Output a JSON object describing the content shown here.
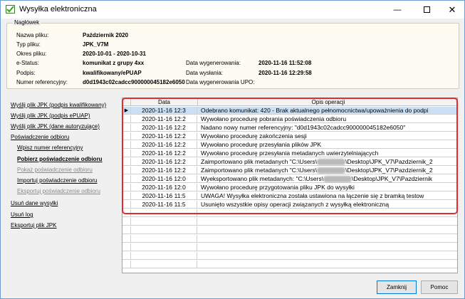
{
  "window": {
    "title": "Wysyłka elektroniczna"
  },
  "header": {
    "legend": "Nagłówek",
    "left": [
      {
        "label": "Nazwa pliku:",
        "value": "Październik 2020"
      },
      {
        "label": "Typ pliku:",
        "value": "JPK_V7M"
      },
      {
        "label": "Okres pliku:",
        "value": "2020-10-01 - 2020-10-31"
      },
      {
        "label": "e-Status:",
        "value": "komunikat z grupy 4xx"
      },
      {
        "label": "Podpis:",
        "value": "kwalifikowany/ePUAP"
      },
      {
        "label": "Numer referencyjny:",
        "value": "d0d1943c02cadcc900000045182e6050"
      }
    ],
    "right": [
      {
        "label": "Data wygenerowania:",
        "value": "2020-11-16 11:52:08"
      },
      {
        "label": "Data wysłania:",
        "value": "2020-11-16 12:29:58"
      },
      {
        "label": "Data wygenerowania UPO:",
        "value": ""
      }
    ]
  },
  "sidebar": [
    {
      "label": "Wyślij plik JPK (podpis kwalifikowany)",
      "disabled": false
    },
    {
      "label": "Wyślij plik JPK (podpis ePUAP)",
      "disabled": false
    },
    {
      "label": "Wyślij plik JPK (dane autoryzujące)",
      "disabled": false
    },
    {
      "label": "Poświadczenie odbioru",
      "disabled": false
    },
    {
      "label": "Wpisz numer referencyjny",
      "disabled": false
    },
    {
      "label": "Pobierz poświadczenie odbioru",
      "disabled": false
    },
    {
      "label": "Pokaż poświadczenie odbioru",
      "disabled": true
    },
    {
      "label": "Importuj poświadczenie odbioru",
      "disabled": false
    },
    {
      "label": "Eksportuj poświadczenie odbioru",
      "disabled": true
    },
    {
      "label": "Usuń dane wysyłki",
      "disabled": false
    },
    {
      "label": "Usuń log",
      "disabled": false
    },
    {
      "label": "Eksportuj plik JPK",
      "disabled": false
    }
  ],
  "grid": {
    "columns": [
      "Data",
      "Opis operacji"
    ],
    "rows": [
      {
        "date": "2020-11-16 12:3",
        "desc": "Odebrano komunikat: 420 - Brak aktualnego pełnomocnictwa/upoważnienia do podpi",
        "selected": true
      },
      {
        "date": "2020-11-16 12:2",
        "desc": "Wywołano procedurę pobrania poświadczenia odbioru"
      },
      {
        "date": "2020-11-16 12:2",
        "desc": "Nadano nowy numer referencyjny: \"d0d1943c02cadcc900000045182e6050\""
      },
      {
        "date": "2020-11-16 12:2",
        "desc": "Wywołano procedurę zakończenia sesji"
      },
      {
        "date": "2020-11-16 12:2",
        "desc": "Wywołano procedurę przesyłania plików JPK"
      },
      {
        "date": "2020-11-16 12:2",
        "desc": "Wywołano procedurę przesyłania metadanych uwierzytelniających"
      },
      {
        "date": "2020-11-16 12:2",
        "desc_a": "Zaimportowano plik metadanych \"C:\\Users\\",
        "desc_b": "\\Desktop\\JPK_V7\\Pazdziernik_2"
      },
      {
        "date": "2020-11-16 12:2",
        "desc_a": "Zaimportowano plik metadanych \"C:\\Users\\",
        "desc_b": "\\Desktop\\JPK_V7\\Pazdziernik_2"
      },
      {
        "date": "2020-11-16 12:0",
        "desc_a": "Wyeksportowano plik metadanych: \"C:\\Users\\",
        "desc_b": "\\Desktop\\JPK_V7\\Pazdziernik"
      },
      {
        "date": "2020-11-16 12:0",
        "desc": "Wywołano procedurę przygotowania pliku JPK do wysyłki"
      },
      {
        "date": "2020-11-16 11:5",
        "desc": "UWAGA! Wysyłka elektroniczna została ustawiona na łączenie się z bramką testow"
      },
      {
        "date": "2020-11-16 11:5",
        "desc": "Usunięto wszystkie opisy operacji związanych z wysyłką elektroniczną"
      }
    ],
    "empty_rows": 7
  },
  "buttons": {
    "close": "Zamknij",
    "help": "Pomoc"
  },
  "colors": {
    "highlight": "#e8282b",
    "selection": "#cce0f5"
  }
}
